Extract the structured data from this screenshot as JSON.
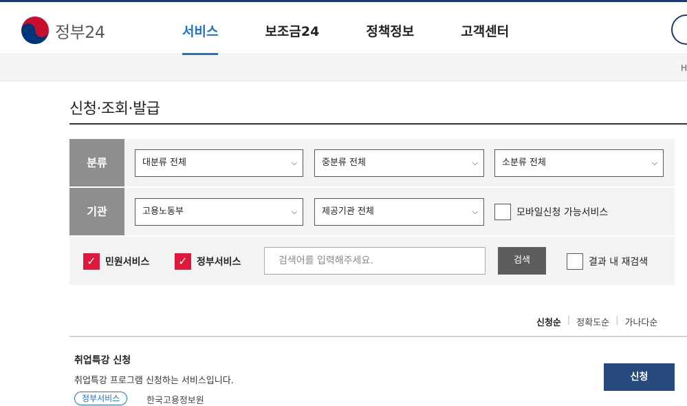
{
  "header": {
    "logo_text": "정부24",
    "nav": [
      "서비스",
      "보조금24",
      "정책정보",
      "고객센터"
    ],
    "active_nav": "서비스"
  },
  "locbar": {
    "home_text": "H"
  },
  "page": {
    "title": "신청·조회·발급"
  },
  "filter": {
    "row1_label": "분류",
    "row2_label": "기관",
    "major_category": "대분류 전체",
    "middle_category": "중분류 전체",
    "minor_category": "소분류 전체",
    "agency": "고용노동부",
    "provider_agency": "제공기관 전체",
    "mobile_label": "모바일신청 가능서비스",
    "mobile_checked": false,
    "civil_label": "민원서비스",
    "civil_checked": true,
    "gov_label": "정부서비스",
    "gov_checked": true,
    "search_placeholder": "검색어를 입력해주세요.",
    "search_button": "검색",
    "research_label": "결과 내 재검색",
    "research_checked": false
  },
  "sort": {
    "options": [
      "신청순",
      "정확도순",
      "가나다순"
    ],
    "active": "신청순"
  },
  "results": [
    {
      "title": "취업특강 신청",
      "description": "취업특강 프로그램 신청하는 서비스입니다.",
      "tag": "정부서비스",
      "org": "한국고용정보원",
      "button": "신청"
    }
  ],
  "colors": {
    "brand_navy": "#1d3a6e",
    "accent_blue": "#1a6fd1",
    "checkbox_red": "#e0183c",
    "apply_button": "#264a7e"
  }
}
